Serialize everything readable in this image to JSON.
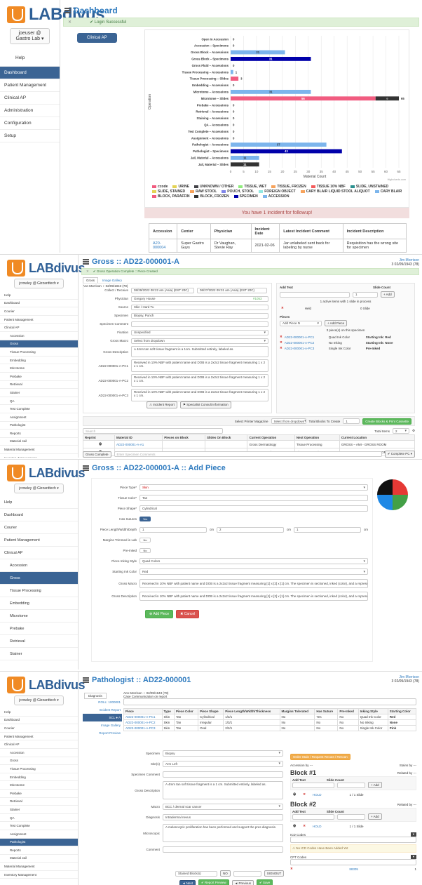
{
  "p1": {
    "logo": "LABdivus",
    "user": "joeuser @ Gastro Lab",
    "nav": [
      {
        "label": "Help",
        "active": false
      },
      {
        "label": "Dashboard",
        "active": true
      },
      {
        "label": "Patient Management",
        "active": false
      },
      {
        "label": "Clinical AP",
        "active": false
      },
      {
        "label": "Administration",
        "active": false
      },
      {
        "label": "Configuration",
        "active": false
      },
      {
        "label": "Setup",
        "active": false
      }
    ],
    "title": "Dashboard",
    "success": "Login Successful",
    "tab": "Clinical AP",
    "chart_data": {
      "type": "bar",
      "orientation": "horizontal",
      "xlabel": "Material Count",
      "ylabel": "Operation",
      "xlim": [
        0,
        65
      ],
      "xticks": [
        0,
        5,
        10,
        15,
        20,
        25,
        30,
        35,
        40,
        45,
        50,
        55,
        60,
        65
      ],
      "grid": true,
      "footer": "Highcharts.com",
      "bars": [
        {
          "label": "Open in Accession",
          "value": 0,
          "color": "#7cb5ec"
        },
        {
          "label": "Accession – Specimens",
          "value": 0,
          "color": "#7cb5ec"
        },
        {
          "label": "Gross Block – Accessions",
          "value": 21,
          "color": "#7cb5ec"
        },
        {
          "label": "Gross Block – Specimens",
          "value": 31,
          "color": "#0000aa"
        },
        {
          "label": "Gross Fluid – Accessions",
          "value": 0,
          "color": "#7cb5ec"
        },
        {
          "label": "Tissue Processing – Accessions",
          "value": 1,
          "color": "#7cb5ec"
        },
        {
          "label": "Tissue Processing – Slides",
          "value": 3,
          "color": "#f15c80"
        },
        {
          "label": "Embedding – Accessions",
          "value": 0,
          "color": "#7cb5ec"
        },
        {
          "label": "Microtome – Accessions",
          "value": 31,
          "color": "#7cb5ec"
        },
        {
          "label": "Microtome – Slides",
          "value": 56,
          "extra": 9,
          "total": 65,
          "color": "#f15c80",
          "extra_color": "#333333"
        },
        {
          "label": "Prebake – Accessions",
          "value": 0,
          "color": "#7cb5ec"
        },
        {
          "label": "Retrieval – Accessions",
          "value": 0,
          "color": "#7cb5ec"
        },
        {
          "label": "Staining – Accessions",
          "value": 0,
          "color": "#7cb5ec"
        },
        {
          "label": "QA – Accessions",
          "value": 0,
          "color": "#7cb5ec"
        },
        {
          "label": "Test Complete – Accessions",
          "value": 0,
          "color": "#7cb5ec"
        },
        {
          "label": "Assignment – Accessions",
          "value": 0,
          "color": "#7cb5ec"
        },
        {
          "label": "Pathologist – Accessions",
          "value": 37,
          "color": "#7cb5ec"
        },
        {
          "label": "Pathologist – Specimens",
          "value": 43,
          "color": "#0000aa"
        },
        {
          "label": "Jail, Material – Accessions",
          "value": 11,
          "color": "#7cb5ec"
        },
        {
          "label": "Jail, Material – Slides",
          "value": 11,
          "color": "#333333"
        }
      ],
      "legend": [
        {
          "name": "ccode",
          "color": "#f15c80"
        },
        {
          "name": "URINE",
          "color": "#e4d354"
        },
        {
          "name": "UNKNOWN / OTHER",
          "color": "#434348"
        },
        {
          "name": "TISSUE, WET",
          "color": "#90ed7d"
        },
        {
          "name": "TISSUE, FROZEN",
          "color": "#f7a35c"
        },
        {
          "name": "TISSUE 10% NBF",
          "color": "#f45b5b"
        },
        {
          "name": "SLIDE, UNSTAINED",
          "color": "#2b908f"
        },
        {
          "name": "SLIDE, STAINED",
          "color": "#e4d354"
        },
        {
          "name": "RAW STOOL",
          "color": "#f7a35c"
        },
        {
          "name": "POUCH, STOOL",
          "color": "#8085e9"
        },
        {
          "name": "FOREIGN OBJECT",
          "color": "#91e8e1"
        },
        {
          "name": "CARY BLAIR LIQUID STOOL ALIQUOT",
          "color": "#f7a35c"
        },
        {
          "name": "CARY BLAIR",
          "color": "#7cb5ec"
        },
        {
          "name": "BLOCK, PARAFFIN",
          "color": "#f15c80"
        },
        {
          "name": "BLOCK, FROZEN",
          "color": "#333333"
        },
        {
          "name": "SPECIMEN",
          "color": "#0000aa"
        },
        {
          "name": "ACCESSION",
          "color": "#7cb5ec"
        }
      ]
    },
    "incident_alert": "You have 1 incident for followup!",
    "incident_headers": [
      "Accession",
      "Center",
      "Physician",
      "Incident Date",
      "Latest Incident Comment",
      "Incident Description"
    ],
    "incident_row": [
      "A20-000004",
      "Super Gastro Guys",
      "Dr Vaughan, Stevie Ray",
      "2021-02-06",
      "Jar unlabeled sent back for labeling by nurse",
      "Requisition has the wrong site for specimen"
    ]
  },
  "p2": {
    "logo": "LABdivus",
    "user": "jcrowley @ Gizzardtech",
    "nav": [
      "Help",
      "Dashboard",
      "Courier",
      "Patient Management",
      "Clinical AP",
      "Accession",
      "Gross",
      "Tissue Processing",
      "Embedding",
      "Microtome",
      "Prebake",
      "Retrieval",
      "Stainer",
      "QA",
      "Test Complete",
      "Assignment",
      "Pathologist",
      "Reports",
      "Material Jail",
      "Material Management",
      "Inventory Management"
    ],
    "active": "Gross",
    "title": "Gross :: AD22-000001-A",
    "success": "Gross Operation Complete :: Piece Created",
    "user_corner": [
      "Jim Morrison",
      "3 02/09/1943 (78)"
    ],
    "tabs": [
      "Gross",
      "Image Gallery"
    ],
    "ann": "Ann Morrison ♀ 02/09/1943 (78)",
    "fields": [
      {
        "label": "Collect / Receive",
        "value": "08/29/2022 08:22 am (Asia) (EST 20C)"
      },
      {
        "label": "Physician",
        "value": "Gregory House"
      },
      {
        "label": "Source",
        "value": "Skin / Hard Tu"
      },
      {
        "label": "Specimen",
        "value": "Biopsy, Punch"
      },
      {
        "label": "Specimen Comment",
        "value": ""
      },
      {
        "label": "Fixation",
        "value": "Unspecified"
      },
      {
        "label": "Gross Macro",
        "value": "Select from dropdown"
      },
      {
        "label": "Gross Description",
        "value": "A 4mm tan soft tissue fragment is a 1cm. Submitted entirely, labeled as."
      },
      {
        "label": "AD22-000001-A-PC1",
        "value": "Received in 10% NBF with patient name and DOB is a 2x2x2 tissue fragment measuring 1 x 2 x 1 cm."
      },
      {
        "label": "AD22-000001-A-PC2",
        "value": "Received in 10% NBF with patient name and DOB is a 2x2x2 tissue fragment measuring 1 x 2 x 1 cm."
      },
      {
        "label": "AD22-000001-A-PC3",
        "value": "Received in 10% NBF with patient name and DOB is a 2x2x2 tissue fragment measuring 1 x 2 x 1 cm."
      }
    ],
    "collect_date2": "08/27/2022 09:31 am (Asia) (EST 20C)",
    "phys_badge": "#1053",
    "btn_incident": "Incident Report",
    "btn_specialist": "Specialist Consult Information",
    "add_text": "Add Text",
    "slide_count": "Slide Count",
    "slide_count_val": "1",
    "add_btn": "+ Add",
    "slides_info": "1 active items with 1 slide in process",
    "held": "Held",
    "held_slides": "0 Slide",
    "pieces_label": "Pieces",
    "piece_select": "Add Piece N",
    "add_piece": "+ Add Piece",
    "pieces_info": "3 piece(s) on this specimen",
    "pieces": [
      {
        "id": "AD22-000001-A-PC1",
        "style": "Quad Ink Color",
        "ink": "Starting Ink: Red"
      },
      {
        "id": "AD22-000001-A-PC2",
        "style": "No Inking",
        "ink": "Starting Ink: None"
      },
      {
        "id": "AD22-000001-A-PC3",
        "style": "Single Ink Color",
        "ink": "Pre-Inked"
      }
    ],
    "printer_label": "Select Printer Magazine",
    "printer_select": "Select from dropdown",
    "total_blocks": "Total Blocks To Create",
    "total_blocks_val": "1",
    "create_btn": "Create Blocks & Print Cassette",
    "search_ph": "Search",
    "total_label": "Total Items",
    "total_val": "2",
    "grid_headers": [
      "Reprint",
      "Material ID",
      "Pieces on Block",
      "Slides On Block",
      "Current Operation",
      "Next Operation",
      "Current Location"
    ],
    "grid_rows": [
      [
        "",
        "AD22-000001-A-A1",
        "",
        "",
        "Gross Dermatology",
        "Tissue Processing",
        "GROSS – AMI - GROSS ROOM"
      ],
      [
        "",
        "AD22-000001-A-A2",
        "1",
        "1",
        "Gross Dermatology",
        "Tissue Processing",
        "GROSS – AMI - GROSS ROOM"
      ]
    ],
    "gross_complete": "Gross Complete",
    "comment_ph": "Enter Specimen Comments",
    "complete_btn": "Complete PC"
  },
  "p3": {
    "logo": "LABdivus",
    "user": "jcrowley @ Gizzardtech",
    "nav": [
      "Help",
      "Dashboard",
      "Courier",
      "Patient Management",
      "Clinical AP",
      "Accession",
      "Gross",
      "Tissue Processing",
      "Embedding",
      "Microtome",
      "Prebake",
      "Retrieval",
      "Stainer"
    ],
    "active": "Gross",
    "title": "Gross :: AD22-000001-A :: Add Piece",
    "fields": [
      {
        "label": "Piece Type*",
        "value": "Skin",
        "kind": "select"
      },
      {
        "label": "Tissue Color*",
        "value": "Tan",
        "kind": "input"
      },
      {
        "label": "Piece Shape*",
        "value": "Cylindrical",
        "kind": "input"
      },
      {
        "label": "Has Sutures",
        "value": "Yes",
        "kind": "toggle"
      }
    ],
    "dims_label": "Piece Length/Width/Depth",
    "dims": [
      "1",
      "2",
      "1"
    ],
    "dim_unit": "cm",
    "margins_label": "Margins Trimmed in Lab",
    "margins_val": "No",
    "preinked_label": "Pre-Inked",
    "preinked_val": "No",
    "fields2": [
      {
        "label": "Piece Inking Style",
        "value": "Quad Colors"
      },
      {
        "label": "Starting Ink Color",
        "value": "Red"
      },
      {
        "label": "Gross Macro",
        "value": "Received in 10% NBF with patient name and DOB is a 2x2x2 tissue fragment measuring [1] x [2] x [1] cm. The specimen is sectioned, inked (color), and a representative section is submitted in 1 cassette."
      },
      {
        "label": "Gross Description",
        "value": "Received in 10% NBF with patient name and DOB is a 2x2x2 tissue fragment measuring [1] x [2] x [1] cm. The specimen is sectioned, inked (color), and a representative section is submitted in 1 cassette."
      }
    ],
    "add_btn": "Add Piece",
    "cancel_btn": "Cancel",
    "pie_colors": [
      "#e53935",
      "#43a047",
      "#1e88e5",
      "#111111"
    ]
  },
  "p4": {
    "logo": "LABdivus",
    "user": "jcrowley @ Gizzardtech",
    "nav": [
      "Help",
      "Dashboard",
      "Courier",
      "Patient Management",
      "Clinical AP",
      "Accession",
      "Gross",
      "Tissue Processing",
      "Embedding",
      "Microtome",
      "Prebake",
      "Retrieval",
      "Stainer",
      "QA",
      "Test Complete",
      "Assignment",
      "Pathologist",
      "Reports",
      "Material Jail",
      "Material Management",
      "Inventory Management"
    ],
    "active": "Pathologist",
    "title": "Pathologist :: AD22-000001",
    "user_corner": [
      "Jim Morrison",
      "3 02/09/1943 (78)"
    ],
    "tab": "Diagnosis",
    "ann": "Ann Morrison ♀ 02/09/1943 (78)",
    "case_comm": "Case Communication on report",
    "left_links": [
      "ROLL: 1000001",
      "Incident Report",
      "SCL ●  A",
      "Image Gallery",
      "Report Preview"
    ],
    "piece_headers": [
      "Piece",
      "Type",
      "Piece Color",
      "Piece Shape",
      "Piece Length/Width/Thickness",
      "Margins Tolerated",
      "Has Suture",
      "Pre-Inked",
      "Inking Style",
      "Starting Color"
    ],
    "piece_rows": [
      [
        "AD22-000001-A-PC1",
        "Skin",
        "Tan",
        "Cylindrical",
        "1/2/1",
        "No",
        "Yes",
        "No",
        "Quad Ink Color",
        "Red"
      ],
      [
        "AD22-000001-A-PC2",
        "Skin",
        "Tan",
        "Irregular",
        "1/3/1",
        "No",
        "No",
        "No",
        "No Inking",
        "None"
      ],
      [
        "AD22-000001-A-PC3",
        "Skin",
        "Tan",
        "Oval",
        "2/2/1",
        "No",
        "No",
        "No",
        "Single Ink Color",
        "Pink"
      ]
    ],
    "orange_btn": "Order Stain / Request Recuts / Rescan",
    "accession_by": "Accession by ---",
    "stains_by": "Stains by ---",
    "block1": "Block #1",
    "block2": "Block #2",
    "related": "Related by ---",
    "add_text": "Add Text",
    "slide_count": "Slide Count",
    "add": "+ Add",
    "slide_info": "1 / 1 Slide",
    "hold": "HOLD",
    "icd_label": "ICD Codes",
    "icd_warn": "No ICD Codes Have Been Added Yet",
    "cpt_label": "CPT Codes",
    "cpt_row": [
      "88305",
      "1"
    ],
    "form": [
      {
        "label": "Specimen",
        "value": "Biopsy"
      },
      {
        "label": "Site(s)",
        "value": "Arm Left"
      },
      {
        "label": "Specimen Comment",
        "value": ""
      },
      {
        "label": "Gross Description",
        "value": "A 4mm tan soft tissue fragment is a 1 cm. Submitted entirely, labeled as."
      },
      {
        "label": "Macro",
        "value": "BCC / dermal scar cancer"
      },
      {
        "label": "Diagnosis",
        "value": "Intradermal nevus"
      },
      {
        "label": "Microscopic",
        "value": "A melanocytic proliferation has been performed and support the pres diagnosis."
      },
      {
        "label": "Comment",
        "value": ""
      }
    ],
    "signout": [
      "Stained Block(s)",
      "NO",
      "",
      "SIGNOUT"
    ],
    "btns": [
      "Next",
      "Report Preview",
      "Previous",
      "Save"
    ]
  }
}
